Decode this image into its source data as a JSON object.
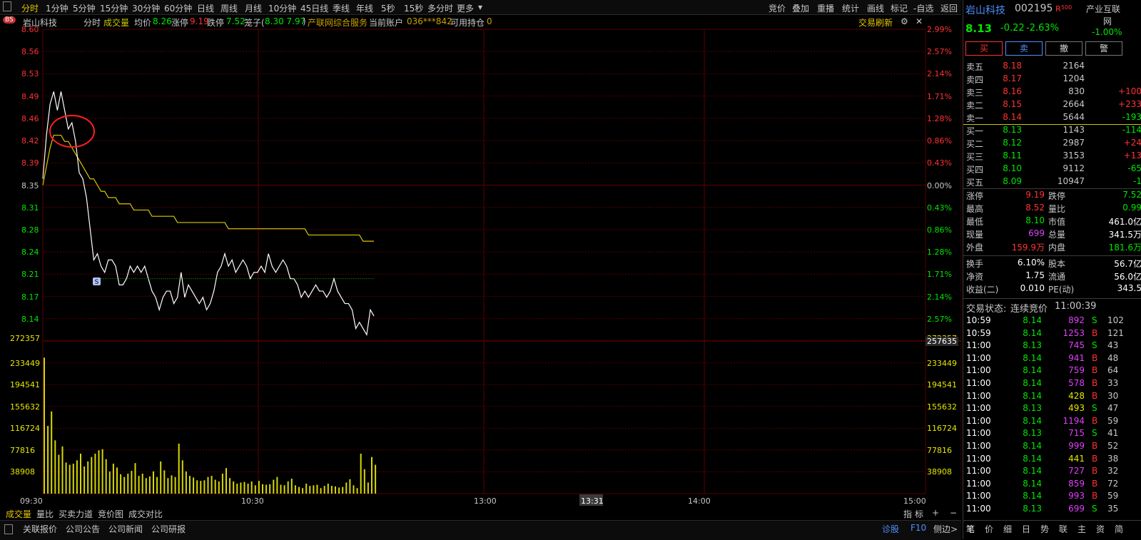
{
  "toolbar": {
    "periods": [
      "分时",
      "1分钟",
      "5分钟",
      "15分钟",
      "30分钟",
      "60分钟",
      "日线",
      "周线",
      "月线",
      "10分钟",
      "45日线",
      "季线",
      "年线",
      "5秒",
      "15秒",
      "多分时",
      "更多"
    ],
    "right": [
      "竞价",
      "叠加",
      "重播",
      "统计",
      "画线",
      "标记",
      "-自选",
      "返回"
    ]
  },
  "info": {
    "bs": "BS",
    "name": "岩山科技",
    "mode": "分时",
    "vol_label": "成交量",
    "avg_label": "均价",
    "avg_value": "8.26",
    "limit_up_label": "涨停",
    "limit_up_value": "9.19",
    "limit_down_label": "跌停",
    "limit_down_value": "7.52",
    "cage_label": "笼子(",
    "cage_value": "8.30 7.97",
    "cage_close": ")",
    "service": "产联网综合服务",
    "account_label": "当前账户",
    "account": "036***842",
    "pos_label": "可用持仓",
    "pos_value": "0",
    "refresh": "交易刷新"
  },
  "axes": {
    "price_ticks": [
      "8.60",
      "8.56",
      "8.53",
      "8.49",
      "8.46",
      "8.42",
      "8.39",
      "8.35",
      "8.31",
      "8.28",
      "8.24",
      "8.21",
      "8.17",
      "8.14"
    ],
    "pct_ticks": [
      "2.99%",
      "2.57%",
      "2.14%",
      "1.71%",
      "1.28%",
      "0.86%",
      "0.43%",
      "0.00%",
      "0.43%",
      "0.86%",
      "1.28%",
      "1.71%",
      "2.14%",
      "2.57%"
    ],
    "vol_ticks": [
      "272357",
      "233449",
      "194541",
      "155632",
      "116724",
      "77816",
      "38908"
    ],
    "vol_current": "257635",
    "time_labels": [
      "09:30",
      "10:30",
      "13:00",
      "14:00",
      "15:00"
    ],
    "cursor_time": "13:31",
    "marker": "S"
  },
  "chart_data": {
    "type": "line",
    "ylim": [
      8.1,
      8.6
    ],
    "vol_ylim": [
      0,
      272357
    ],
    "price": [
      8.36,
      8.43,
      8.48,
      8.5,
      8.47,
      8.5,
      8.47,
      8.44,
      8.45,
      8.42,
      8.37,
      8.36,
      8.33,
      8.28,
      8.23,
      8.24,
      8.22,
      8.21,
      8.23,
      8.23,
      8.22,
      8.19,
      8.19,
      8.2,
      8.22,
      8.21,
      8.22,
      8.21,
      8.22,
      8.2,
      8.18,
      8.17,
      8.15,
      8.17,
      8.18,
      8.18,
      8.16,
      8.17,
      8.21,
      8.17,
      8.19,
      8.18,
      8.17,
      8.16,
      8.17,
      8.15,
      8.16,
      8.18,
      8.21,
      8.22,
      8.24,
      8.22,
      8.23,
      8.21,
      8.22,
      8.23,
      8.22,
      8.2,
      8.21,
      8.21,
      8.22,
      8.21,
      8.24,
      8.22,
      8.21,
      8.22,
      8.23,
      8.22,
      8.2,
      8.2,
      8.19,
      8.17,
      8.18,
      8.17,
      8.18,
      8.19,
      8.18,
      8.18,
      8.17,
      8.18,
      8.2,
      8.18,
      8.17,
      8.16,
      8.16,
      8.15,
      8.12,
      8.13,
      8.12,
      8.11,
      8.15,
      8.14
    ],
    "avg": [
      8.35,
      8.38,
      8.41,
      8.43,
      8.43,
      8.43,
      8.42,
      8.42,
      8.41,
      8.4,
      8.39,
      8.38,
      8.37,
      8.36,
      8.36,
      8.35,
      8.34,
      8.34,
      8.33,
      8.33,
      8.33,
      8.32,
      8.32,
      8.32,
      8.32,
      8.31,
      8.31,
      8.31,
      8.31,
      8.31,
      8.3,
      8.3,
      8.3,
      8.3,
      8.3,
      8.3,
      8.3,
      8.29,
      8.29,
      8.29,
      8.29,
      8.29,
      8.29,
      8.29,
      8.29,
      8.29,
      8.29,
      8.29,
      8.29,
      8.29,
      8.29,
      8.28,
      8.28,
      8.28,
      8.28,
      8.28,
      8.28,
      8.28,
      8.28,
      8.28,
      8.28,
      8.28,
      8.28,
      8.28,
      8.28,
      8.28,
      8.28,
      8.28,
      8.28,
      8.28,
      8.28,
      8.28,
      8.28,
      8.27,
      8.27,
      8.27,
      8.27,
      8.27,
      8.27,
      8.27,
      8.27,
      8.27,
      8.27,
      8.27,
      8.27,
      8.27,
      8.27,
      8.27,
      8.26,
      8.26,
      8.26,
      8.26
    ],
    "volume": [
      245000,
      122000,
      148000,
      96000,
      70000,
      85000,
      56000,
      52000,
      54000,
      60000,
      72000,
      49000,
      58000,
      66000,
      72000,
      78000,
      80000,
      62000,
      40000,
      54000,
      47000,
      35000,
      30000,
      36000,
      41000,
      55000,
      32000,
      36000,
      28000,
      31000,
      40000,
      30000,
      58000,
      42000,
      28000,
      33000,
      30000,
      90000,
      60000,
      40000,
      32000,
      29000,
      24000,
      23000,
      24000,
      30000,
      32000,
      25000,
      22000,
      36000,
      46000,
      28000,
      22000,
      18000,
      20000,
      21000,
      18000,
      22000,
      15000,
      23000,
      17000,
      16000,
      17000,
      25000,
      30000,
      16000,
      15000,
      22000,
      27000,
      15000,
      12000,
      10000,
      18000,
      14000,
      15000,
      16000,
      10000,
      14000,
      18000,
      14000,
      13000,
      11000,
      12000,
      20000,
      26000,
      15000,
      10000,
      72000,
      44000,
      20000,
      66000,
      52000
    ]
  },
  "bottom_tabs": [
    "成交量",
    "量比",
    "买卖力道",
    "竞价图",
    "成交对比"
  ],
  "bottom_right": [
    "指",
    "标",
    "+",
    "−"
  ],
  "bottom_bar": [
    "关联报价",
    "公司公告",
    "公司新闻",
    "公司研报",
    "诊股",
    "F10",
    "侧边>"
  ],
  "colors": {
    "red": "#ff3232",
    "green": "#00e600",
    "yellow": "#e6e600",
    "magenta": "#e040fb",
    "blue": "#4f8fff",
    "grid": "#5a0000"
  },
  "quote": {
    "name": "岩山科技",
    "code": "002195",
    "flag": "R",
    "flag_sub": "500",
    "industry": "产业互联",
    "industry2": "网",
    "industry_pct": "-1.00%",
    "price": "8.13",
    "change": "-0.22",
    "change_pct": "-2.63%",
    "buttons": [
      "买",
      "卖",
      "撤",
      "警"
    ],
    "asks": [
      {
        "label": "卖五",
        "price": "8.18",
        "vol": "2164",
        "chg": ""
      },
      {
        "label": "卖四",
        "price": "8.17",
        "vol": "1204",
        "chg": ""
      },
      {
        "label": "卖三",
        "price": "8.16",
        "vol": "830",
        "chg": "+100"
      },
      {
        "label": "卖二",
        "price": "8.15",
        "vol": "2664",
        "chg": "+233"
      },
      {
        "label": "卖一",
        "price": "8.14",
        "vol": "5644",
        "chg": "-193"
      }
    ],
    "bids": [
      {
        "label": "买一",
        "price": "8.13",
        "vol": "1143",
        "chg": "-114"
      },
      {
        "label": "买二",
        "price": "8.12",
        "vol": "2987",
        "chg": "+24"
      },
      {
        "label": "买三",
        "price": "8.11",
        "vol": "3153",
        "chg": "+13"
      },
      {
        "label": "买四",
        "price": "8.10",
        "vol": "9112",
        "chg": "-65"
      },
      {
        "label": "买五",
        "price": "8.09",
        "vol": "10947",
        "chg": "-1"
      }
    ],
    "stats1": [
      {
        "l1": "涨停",
        "v1": "9.19",
        "c1": "red",
        "l2": "跌停",
        "v2": "7.52",
        "c2": "green"
      },
      {
        "l1": "最高",
        "v1": "8.52",
        "c1": "red",
        "l2": "量比",
        "v2": "0.99",
        "c2": "green"
      },
      {
        "l1": "最低",
        "v1": "8.10",
        "c1": "green",
        "l2": "市值",
        "v2": "461.0亿",
        "c2": "white"
      },
      {
        "l1": "现量",
        "v1": "699",
        "c1": "magenta",
        "l2": "总量",
        "v2": "341.5万",
        "c2": "white"
      },
      {
        "l1": "外盘",
        "v1": "159.9万",
        "c1": "red",
        "l2": "内盘",
        "v2": "181.6万",
        "c2": "green"
      }
    ],
    "stats2": [
      {
        "l1": "换手",
        "v1": "6.10%",
        "l2": "股本",
        "v2": "56.7亿"
      },
      {
        "l1": "净资",
        "v1": "1.75",
        "l2": "流通",
        "v2": "56.0亿"
      },
      {
        "l1": "收益(二)",
        "v1": "0.010",
        "l2": "PE(动)",
        "v2": "343.5"
      }
    ],
    "status_label": "交易状态:",
    "status": "连续竞价",
    "status_time": "11:00:39",
    "trades": [
      {
        "t": "10:59",
        "p": "8.14",
        "v": "892",
        "c": "magenta",
        "s": "S",
        "n": "102"
      },
      {
        "t": "10:59",
        "p": "8.14",
        "v": "1253",
        "c": "magenta",
        "s": "B",
        "n": "121"
      },
      {
        "t": "11:00",
        "p": "8.13",
        "v": "745",
        "c": "magenta",
        "s": "S",
        "n": "43"
      },
      {
        "t": "11:00",
        "p": "8.14",
        "v": "941",
        "c": "magenta",
        "s": "B",
        "n": "48"
      },
      {
        "t": "11:00",
        "p": "8.14",
        "v": "759",
        "c": "magenta",
        "s": "B",
        "n": "64"
      },
      {
        "t": "11:00",
        "p": "8.14",
        "v": "578",
        "c": "magenta",
        "s": "B",
        "n": "33"
      },
      {
        "t": "11:00",
        "p": "8.14",
        "v": "428",
        "c": "yellow",
        "s": "B",
        "n": "30"
      },
      {
        "t": "11:00",
        "p": "8.13",
        "v": "493",
        "c": "yellow",
        "s": "S",
        "n": "47"
      },
      {
        "t": "11:00",
        "p": "8.14",
        "v": "1194",
        "c": "magenta",
        "s": "B",
        "n": "59"
      },
      {
        "t": "11:00",
        "p": "8.13",
        "v": "715",
        "c": "magenta",
        "s": "S",
        "n": "41"
      },
      {
        "t": "11:00",
        "p": "8.14",
        "v": "999",
        "c": "magenta",
        "s": "B",
        "n": "52"
      },
      {
        "t": "11:00",
        "p": "8.14",
        "v": "441",
        "c": "yellow",
        "s": "B",
        "n": "38"
      },
      {
        "t": "11:00",
        "p": "8.14",
        "v": "727",
        "c": "magenta",
        "s": "B",
        "n": "32"
      },
      {
        "t": "11:00",
        "p": "8.14",
        "v": "859",
        "c": "magenta",
        "s": "B",
        "n": "72"
      },
      {
        "t": "11:00",
        "p": "8.14",
        "v": "993",
        "c": "magenta",
        "s": "B",
        "n": "59"
      },
      {
        "t": "11:00",
        "p": "8.13",
        "v": "699",
        "c": "magenta",
        "s": "S",
        "n": "35"
      }
    ],
    "bottom_tabs": [
      "笔",
      "价",
      "细",
      "日",
      "势",
      "联",
      "主",
      "资",
      "简"
    ]
  }
}
